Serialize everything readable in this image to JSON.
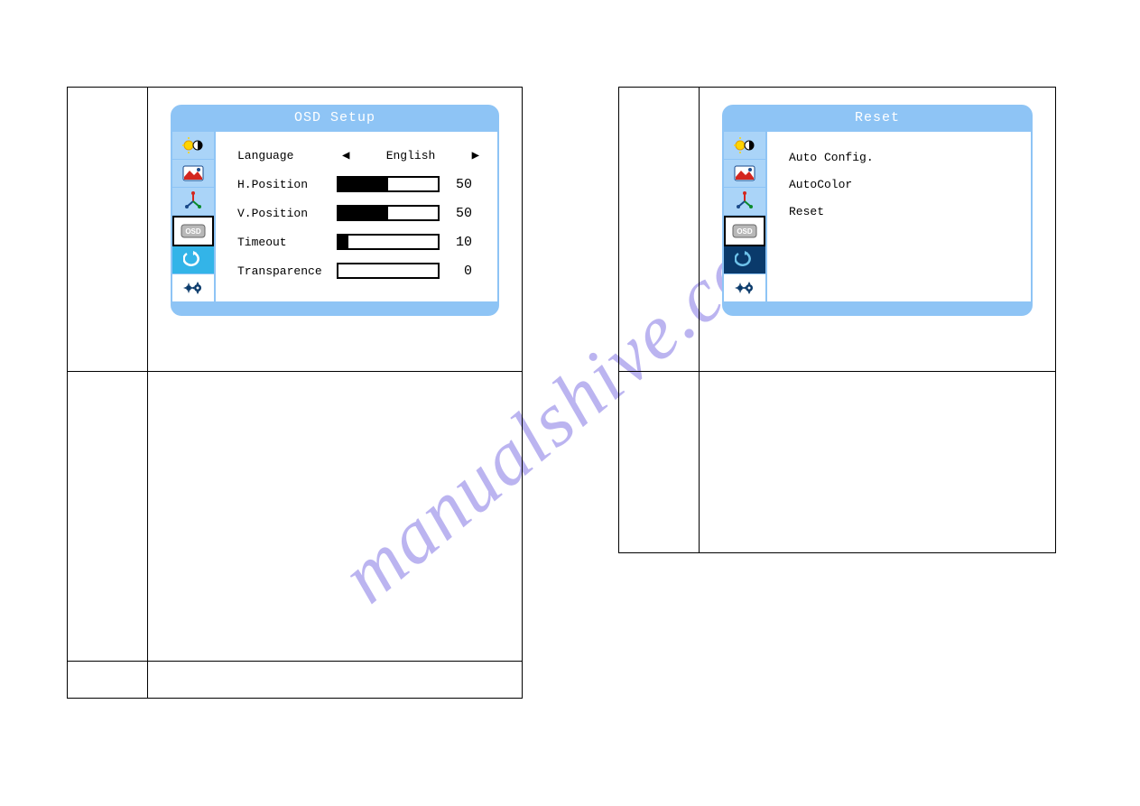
{
  "watermark": "manualshive.com",
  "left_panel": {
    "title": "OSD Setup",
    "sidebar_active_index": 3,
    "items": {
      "language": {
        "label": "Language",
        "value": "English"
      },
      "h_position": {
        "label": "H.Position",
        "value": 50,
        "max": 100
      },
      "v_position": {
        "label": "V.Position",
        "value": 50,
        "max": 100
      },
      "timeout": {
        "label": "Timeout",
        "value": 10,
        "max": 100
      },
      "transparence": {
        "label": "Transparence",
        "value": 0,
        "max": 100
      }
    }
  },
  "right_panel": {
    "title": "Reset",
    "sidebar_active_index": 4,
    "items": [
      "Auto Config.",
      "AutoColor",
      "Reset"
    ]
  },
  "sidebar_icons": [
    "brightness-contrast-icon",
    "image-icon",
    "color-temp-icon",
    "osd-icon",
    "reset-icon",
    "misc-icon"
  ]
}
